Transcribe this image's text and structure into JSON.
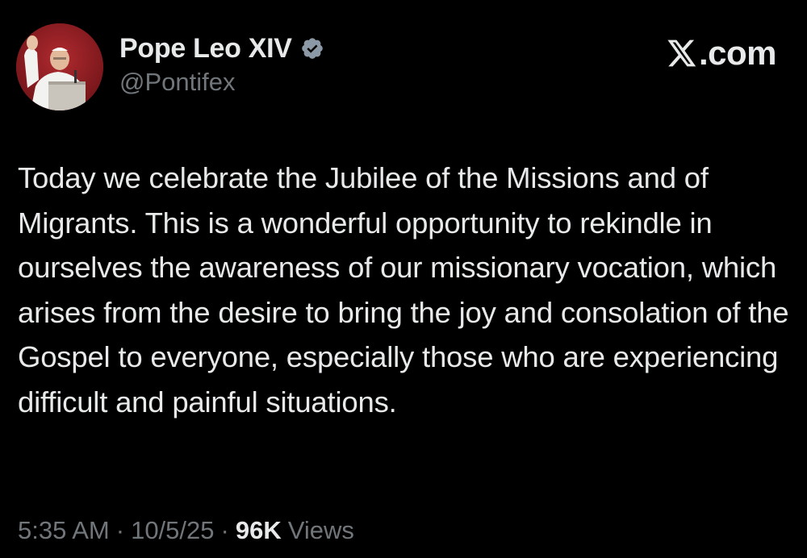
{
  "author": {
    "display_name": "Pope Leo XIV",
    "handle": "@Pontifex",
    "verified": true,
    "avatar_icon": "profile-photo"
  },
  "brand": {
    "logo_text": ".com",
    "logo_icon": "x-logo-icon"
  },
  "post": {
    "text": "Today we celebrate the Jubilee of the Missions and of Migrants. This is a wonderful opportunity to rekindle in ourselves the awareness of our missionary vocation, which arises from the desire to bring the joy and consolation of the Gospel to everyone, especially those who are experiencing difficult and painful situations."
  },
  "meta": {
    "time": "5:35 AM",
    "date": "10/5/25",
    "separator": "·",
    "views_count": "96K",
    "views_label": "Views"
  },
  "colors": {
    "background": "#000000",
    "primary_text": "#e7e9ea",
    "secondary_text": "#71767b",
    "verified_badge": "#8b98a5"
  }
}
